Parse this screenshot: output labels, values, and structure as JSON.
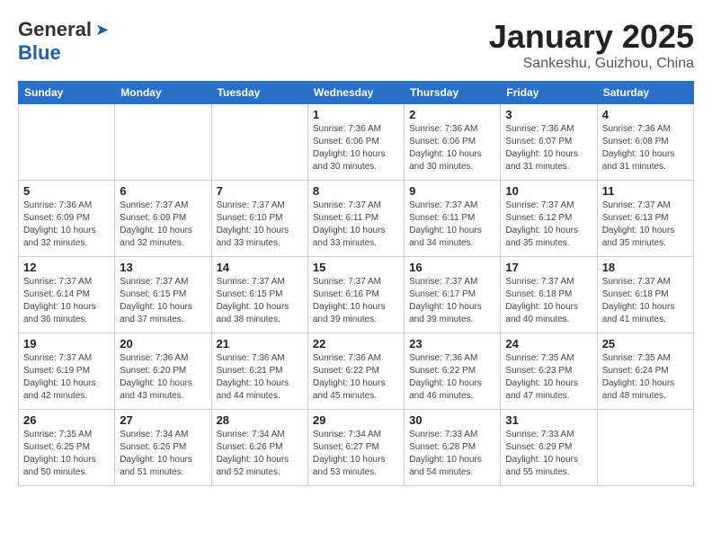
{
  "header": {
    "logo_general": "General",
    "logo_blue": "Blue",
    "title": "January 2025",
    "location": "Sankeshu, Guizhou, China"
  },
  "days_of_week": [
    "Sunday",
    "Monday",
    "Tuesday",
    "Wednesday",
    "Thursday",
    "Friday",
    "Saturday"
  ],
  "weeks": [
    [
      {
        "day": "",
        "info": ""
      },
      {
        "day": "",
        "info": ""
      },
      {
        "day": "",
        "info": ""
      },
      {
        "day": "1",
        "info": "Sunrise: 7:36 AM\nSunset: 6:06 PM\nDaylight: 10 hours\nand 30 minutes."
      },
      {
        "day": "2",
        "info": "Sunrise: 7:36 AM\nSunset: 6:06 PM\nDaylight: 10 hours\nand 30 minutes."
      },
      {
        "day": "3",
        "info": "Sunrise: 7:36 AM\nSunset: 6:07 PM\nDaylight: 10 hours\nand 31 minutes."
      },
      {
        "day": "4",
        "info": "Sunrise: 7:36 AM\nSunset: 6:08 PM\nDaylight: 10 hours\nand 31 minutes."
      }
    ],
    [
      {
        "day": "5",
        "info": "Sunrise: 7:36 AM\nSunset: 6:09 PM\nDaylight: 10 hours\nand 32 minutes."
      },
      {
        "day": "6",
        "info": "Sunrise: 7:37 AM\nSunset: 6:09 PM\nDaylight: 10 hours\nand 32 minutes."
      },
      {
        "day": "7",
        "info": "Sunrise: 7:37 AM\nSunset: 6:10 PM\nDaylight: 10 hours\nand 33 minutes."
      },
      {
        "day": "8",
        "info": "Sunrise: 7:37 AM\nSunset: 6:11 PM\nDaylight: 10 hours\nand 33 minutes."
      },
      {
        "day": "9",
        "info": "Sunrise: 7:37 AM\nSunset: 6:11 PM\nDaylight: 10 hours\nand 34 minutes."
      },
      {
        "day": "10",
        "info": "Sunrise: 7:37 AM\nSunset: 6:12 PM\nDaylight: 10 hours\nand 35 minutes."
      },
      {
        "day": "11",
        "info": "Sunrise: 7:37 AM\nSunset: 6:13 PM\nDaylight: 10 hours\nand 35 minutes."
      }
    ],
    [
      {
        "day": "12",
        "info": "Sunrise: 7:37 AM\nSunset: 6:14 PM\nDaylight: 10 hours\nand 36 minutes."
      },
      {
        "day": "13",
        "info": "Sunrise: 7:37 AM\nSunset: 6:15 PM\nDaylight: 10 hours\nand 37 minutes."
      },
      {
        "day": "14",
        "info": "Sunrise: 7:37 AM\nSunset: 6:15 PM\nDaylight: 10 hours\nand 38 minutes."
      },
      {
        "day": "15",
        "info": "Sunrise: 7:37 AM\nSunset: 6:16 PM\nDaylight: 10 hours\nand 39 minutes."
      },
      {
        "day": "16",
        "info": "Sunrise: 7:37 AM\nSunset: 6:17 PM\nDaylight: 10 hours\nand 39 minutes."
      },
      {
        "day": "17",
        "info": "Sunrise: 7:37 AM\nSunset: 6:18 PM\nDaylight: 10 hours\nand 40 minutes."
      },
      {
        "day": "18",
        "info": "Sunrise: 7:37 AM\nSunset: 6:18 PM\nDaylight: 10 hours\nand 41 minutes."
      }
    ],
    [
      {
        "day": "19",
        "info": "Sunrise: 7:37 AM\nSunset: 6:19 PM\nDaylight: 10 hours\nand 42 minutes."
      },
      {
        "day": "20",
        "info": "Sunrise: 7:36 AM\nSunset: 6:20 PM\nDaylight: 10 hours\nand 43 minutes."
      },
      {
        "day": "21",
        "info": "Sunrise: 7:36 AM\nSunset: 6:21 PM\nDaylight: 10 hours\nand 44 minutes."
      },
      {
        "day": "22",
        "info": "Sunrise: 7:36 AM\nSunset: 6:22 PM\nDaylight: 10 hours\nand 45 minutes."
      },
      {
        "day": "23",
        "info": "Sunrise: 7:36 AM\nSunset: 6:22 PM\nDaylight: 10 hours\nand 46 minutes."
      },
      {
        "day": "24",
        "info": "Sunrise: 7:35 AM\nSunset: 6:23 PM\nDaylight: 10 hours\nand 47 minutes."
      },
      {
        "day": "25",
        "info": "Sunrise: 7:35 AM\nSunset: 6:24 PM\nDaylight: 10 hours\nand 48 minutes."
      }
    ],
    [
      {
        "day": "26",
        "info": "Sunrise: 7:35 AM\nSunset: 6:25 PM\nDaylight: 10 hours\nand 50 minutes."
      },
      {
        "day": "27",
        "info": "Sunrise: 7:34 AM\nSunset: 6:26 PM\nDaylight: 10 hours\nand 51 minutes."
      },
      {
        "day": "28",
        "info": "Sunrise: 7:34 AM\nSunset: 6:26 PM\nDaylight: 10 hours\nand 52 minutes."
      },
      {
        "day": "29",
        "info": "Sunrise: 7:34 AM\nSunset: 6:27 PM\nDaylight: 10 hours\nand 53 minutes."
      },
      {
        "day": "30",
        "info": "Sunrise: 7:33 AM\nSunset: 6:28 PM\nDaylight: 10 hours\nand 54 minutes."
      },
      {
        "day": "31",
        "info": "Sunrise: 7:33 AM\nSunset: 6:29 PM\nDaylight: 10 hours\nand 55 minutes."
      },
      {
        "day": "",
        "info": ""
      }
    ]
  ]
}
